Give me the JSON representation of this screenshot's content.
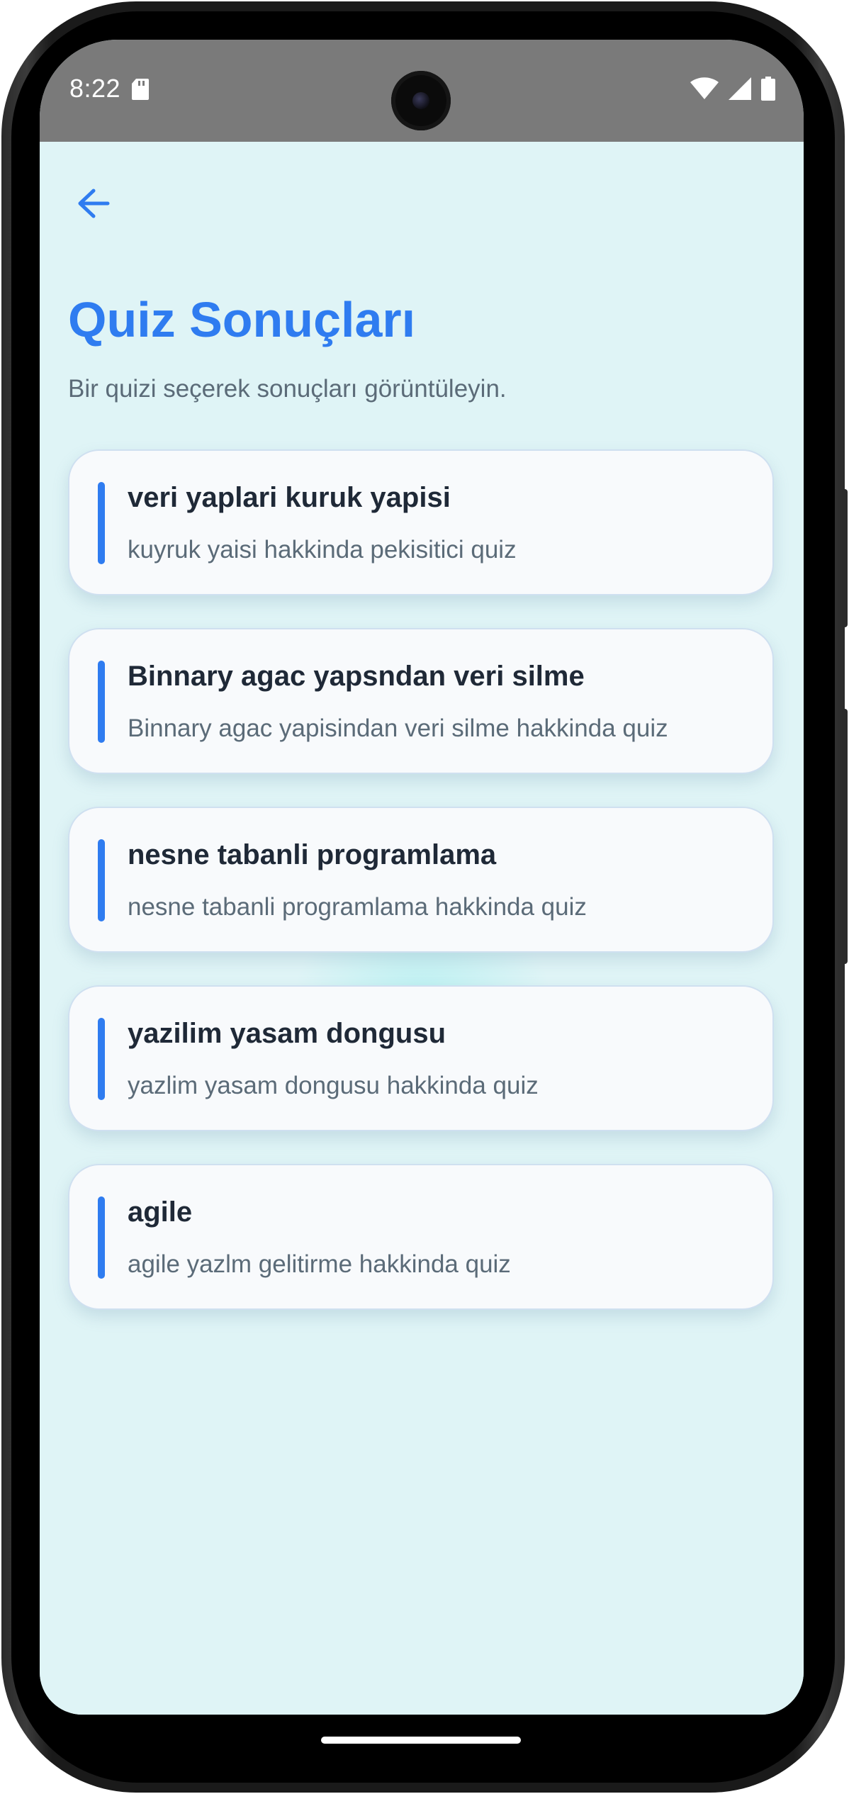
{
  "status_bar": {
    "time": "8:22",
    "icons": [
      "sd-card-icon",
      "wifi-icon",
      "cell-signal-icon",
      "battery-icon"
    ]
  },
  "header": {
    "back_icon": "arrow-left-icon",
    "title": "Quiz Sonuçları",
    "subtitle": "Bir quizi seçerek sonuçları görüntüleyin."
  },
  "quizzes": [
    {
      "title": "veri yaplari kuruk yapisi",
      "description": "kuyruk yaisi hakkinda pekisitici quiz"
    },
    {
      "title": "Binnary agac yapsndan veri silme",
      "description": "Binnary agac yapisindan veri silme hakkinda quiz"
    },
    {
      "title": "nesne tabanli programlama",
      "description": "nesne tabanli programlama hakkinda quiz"
    },
    {
      "title": "yazilim yasam dongusu",
      "description": "yazlim yasam dongusu hakkinda quiz"
    },
    {
      "title": "agile",
      "description": "agile yazlm gelitirme hakkinda quiz"
    }
  ],
  "colors": {
    "accent": "#2f7cf0",
    "background": "#dff4f6",
    "card": "#f8fafc",
    "title_text": "#1f2937",
    "muted_text": "#5b6b78",
    "status_bar": "#7a7a7a"
  }
}
